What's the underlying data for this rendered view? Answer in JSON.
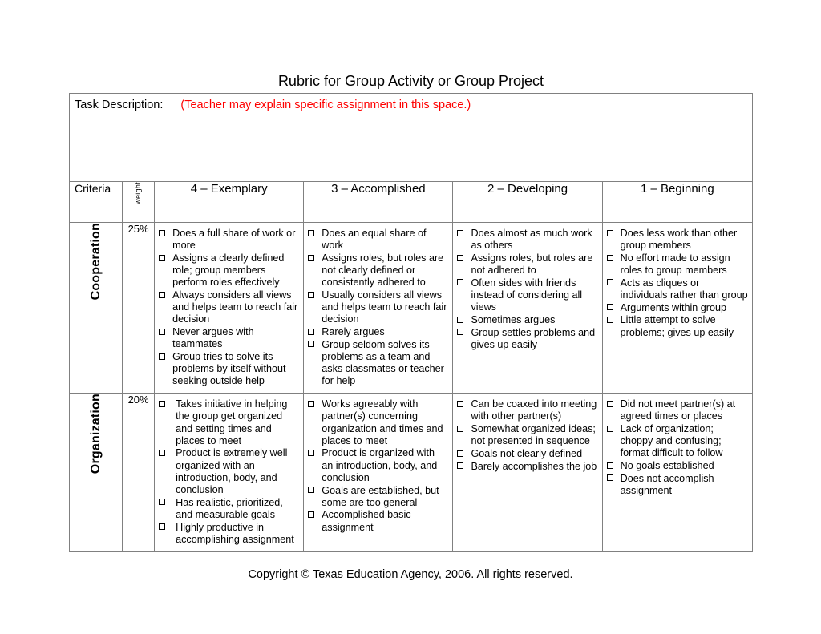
{
  "document": {
    "title": "Rubric for Group Activity or Group Project",
    "footer": "Copyright © Texas Education Agency, 2006.  All rights reserved."
  },
  "colors": {
    "hint_red": "#FF0000",
    "border_gray": "#808080",
    "text_black": "#000000"
  },
  "task": {
    "label": "Task Description:",
    "hint": "(Teacher may explain specific assignment in this space.)"
  },
  "header": {
    "criteria": "Criteria",
    "weight": "weight",
    "levels": [
      "4 – Exemplary",
      "3 – Accomplished",
      "2 – Developing",
      "1 – Beginning"
    ]
  },
  "rows": [
    {
      "name": "Cooperation",
      "weight": "25%",
      "exemplary": [
        "Does a full share of work or more",
        "Assigns a clearly defined role; group members perform roles effectively",
        "Always considers all views and helps team to reach fair decision",
        "Never argues with teammates",
        "Group tries to solve its problems by itself without seeking outside help"
      ],
      "accomplished": [
        "Does an equal share of work",
        "Assigns roles, but roles are not clearly defined or consistently adhered to",
        "Usually considers all views and helps team to reach fair decision",
        "Rarely argues",
        "Group seldom solves its problems as a team and asks classmates or teacher for help"
      ],
      "developing": [
        "Does almost as much work as others",
        "Assigns roles, but roles are not adhered to",
        "Often sides with friends instead of considering all views",
        "Sometimes argues",
        "Group settles problems and gives up easily"
      ],
      "beginning": [
        "Does less work than other group members",
        "No effort made to assign roles to group members",
        "Acts as cliques or individuals rather than group",
        "Arguments within group",
        "Little attempt to solve problems; gives up easily"
      ]
    },
    {
      "name": "Organization",
      "weight": "20%",
      "exemplary": [
        "Takes initiative in helping the group get organized and setting times and places to meet",
        "Product is extremely well organized with an introduction, body, and conclusion",
        "Has realistic, prioritized, and measurable goals",
        "Highly productive in accomplishing assignment"
      ],
      "accomplished": [
        "Works agreeably with partner(s) concerning organization and times and places to meet",
        "Product is organized with an introduction, body, and conclusion",
        "Goals are established, but some are too general",
        "Accomplished basic assignment"
      ],
      "developing": [
        "Can be coaxed into meeting with other partner(s)",
        "Somewhat organized ideas; not presented in sequence",
        "Goals not clearly defined",
        "Barely accomplishes the job"
      ],
      "beginning": [
        "Did not meet partner(s) at agreed times or places",
        "Lack of organization; choppy and confusing; format difficult to follow",
        "No goals established",
        "Does not accomplish assignment"
      ]
    }
  ]
}
